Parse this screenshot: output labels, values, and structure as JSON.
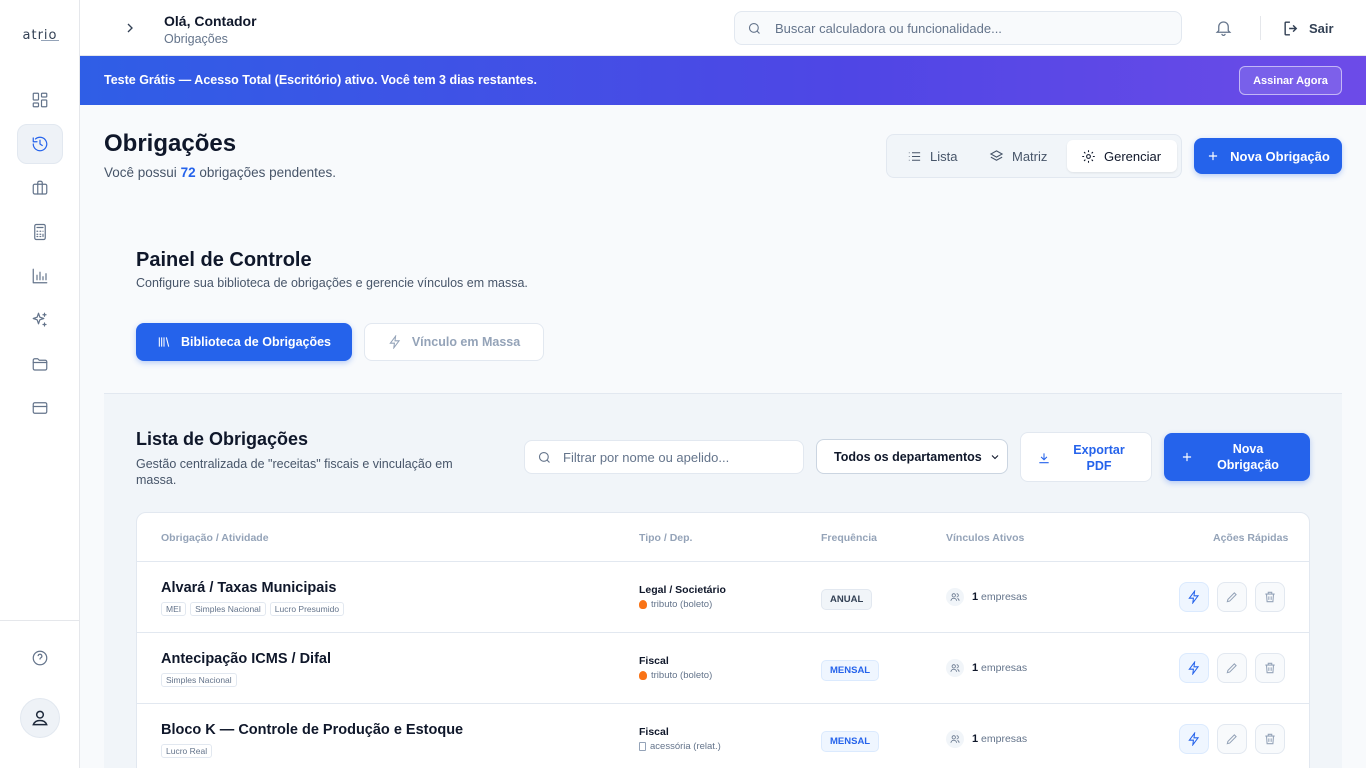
{
  "brand": {
    "logo_text": "atrio",
    "logo_sub": ""
  },
  "sidebar": {
    "items": [
      {
        "name": "dashboard-icon"
      },
      {
        "name": "history-icon",
        "active": true
      },
      {
        "name": "briefcase-icon"
      },
      {
        "name": "calculator-icon"
      },
      {
        "name": "bar-chart-icon"
      },
      {
        "name": "sparkles-icon"
      },
      {
        "name": "folder-icon"
      },
      {
        "name": "credit-card-icon"
      }
    ]
  },
  "topbar": {
    "greeting": "Olá, Contador",
    "subtitle": "Obrigações",
    "search_placeholder": "Buscar calculadora ou funcionalidade...",
    "logout_label": "Sair"
  },
  "banner": {
    "text": "Teste Grátis — Acesso Total (Escritório) ativo. Você tem 3 dias restantes.",
    "cta": "Assinar Agora"
  },
  "page": {
    "title": "Obrigações",
    "subtitle_prefix": "Você possui ",
    "pending_count": "72",
    "subtitle_suffix": " obrigações pendentes.",
    "views": {
      "lista": "Lista",
      "matriz": "Matriz",
      "gerenciar": "Gerenciar",
      "active": "gerenciar"
    },
    "new_button": "Nova Obrigação"
  },
  "panel": {
    "title": "Painel de Controle",
    "subtitle": "Configure sua biblioteca de obrigações e gerencie vínculos em massa.",
    "tab_library": "Biblioteca de Obrigações",
    "tab_bulk": "Vínculo em Massa"
  },
  "list": {
    "title": "Lista de Obrigações",
    "subtitle": "Gestão centralizada de \"receitas\" fiscais e vinculação em massa.",
    "filter_placeholder": "Filtrar por nome ou apelido...",
    "department_selected": "Todos os departamentos",
    "export_label": "Exportar PDF",
    "new_label": "Nova Obrigação",
    "columns": {
      "name": "Obrigação / Atividade",
      "type": "Tipo / Dep.",
      "frequency": "Frequência",
      "links": "Vínculos Ativos",
      "actions": "Ações Rápidas"
    },
    "rows": [
      {
        "name": "Alvará / Taxas Municipais",
        "tags": [
          "MEI",
          "Simples Nacional",
          "Lucro Presumido"
        ],
        "type": "Legal / Societário",
        "subtype": "tributo (boleto)",
        "subtype_icon": "fire-icon",
        "frequency": "ANUAL",
        "links_count": "1",
        "links_label": "empresas"
      },
      {
        "name": "Antecipação ICMS / Difal",
        "tags": [
          "Simples Nacional"
        ],
        "type": "Fiscal",
        "subtype": "tributo (boleto)",
        "subtype_icon": "fire-icon",
        "frequency": "MENSAL",
        "links_count": "1",
        "links_label": "empresas"
      },
      {
        "name": "Bloco K — Controle de Produção e Estoque",
        "tags": [
          "Lucro Real"
        ],
        "type": "Fiscal",
        "subtype": "acessória (relat.)",
        "subtype_icon": "document-icon",
        "frequency": "MENSAL",
        "links_count": "1",
        "links_label": "empresas"
      }
    ]
  },
  "colors": {
    "primary": "#2563eb",
    "banner_start": "#2f5ee6",
    "banner_end": "#6d4be8"
  }
}
